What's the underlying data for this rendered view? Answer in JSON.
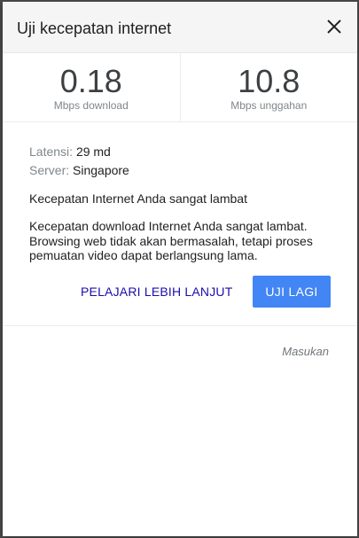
{
  "dialog": {
    "title": "Uji kecepatan internet",
    "close_icon": "close-icon"
  },
  "speeds": {
    "download": {
      "value": "0.18",
      "unit": "Mbps download"
    },
    "upload": {
      "value": "10.8",
      "unit": "Mbps unggahan"
    }
  },
  "details": {
    "latency_label": "Latensi:",
    "latency_value": "29 md",
    "server_label": "Server:",
    "server_value": "Singapore",
    "summary": "Kecepatan Internet Anda sangat lambat",
    "description": "Kecepatan download Internet Anda sangat lambat. Browsing web tidak akan bermasalah, tetapi proses pemuatan video dapat berlangsung lama."
  },
  "actions": {
    "learn_more_label": "PELAJARI LEBIH LANJUT",
    "retry_label": "UJI LAGI"
  },
  "footer": {
    "feedback_label": "Masukan"
  },
  "colors": {
    "accent": "#4285f4",
    "link": "#1a0dab"
  }
}
